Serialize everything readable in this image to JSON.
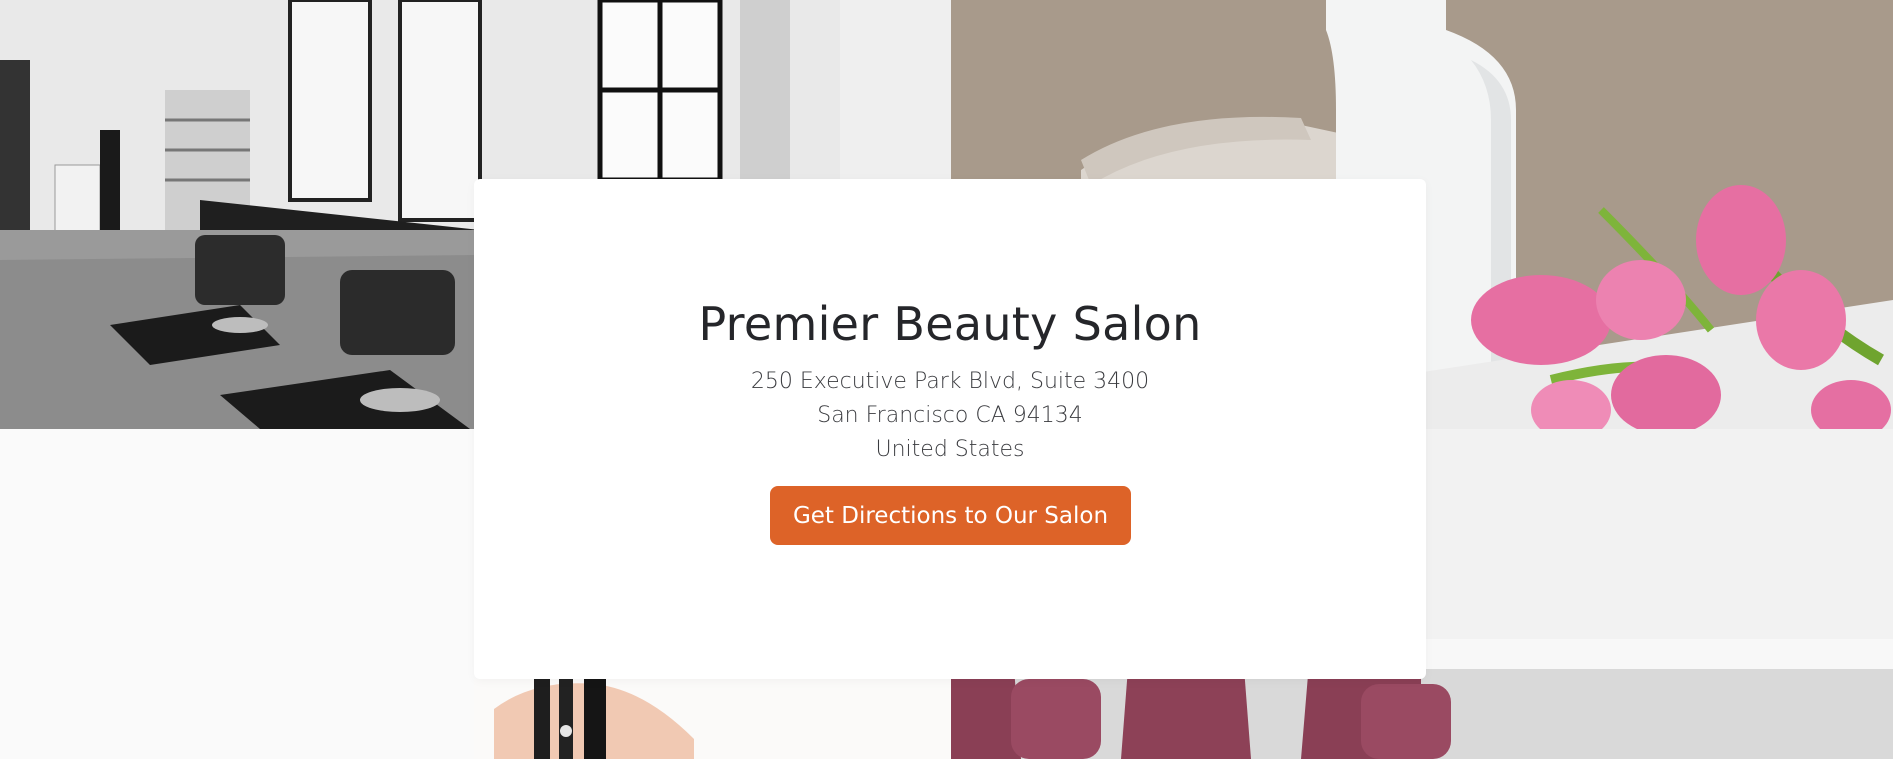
{
  "salon": {
    "name": "Premier Beauty Salon",
    "address": {
      "line1": "250 Executive Park Blvd, Suite 3400",
      "line2": "San Francisco CA 94134",
      "line3": "United States"
    },
    "directions_button": "Get Directions to Our Salon"
  },
  "colors": {
    "accent": "#dd6328",
    "card_background": "#ffffff",
    "page_background": "#fafafa",
    "heading_text": "#25262a"
  }
}
